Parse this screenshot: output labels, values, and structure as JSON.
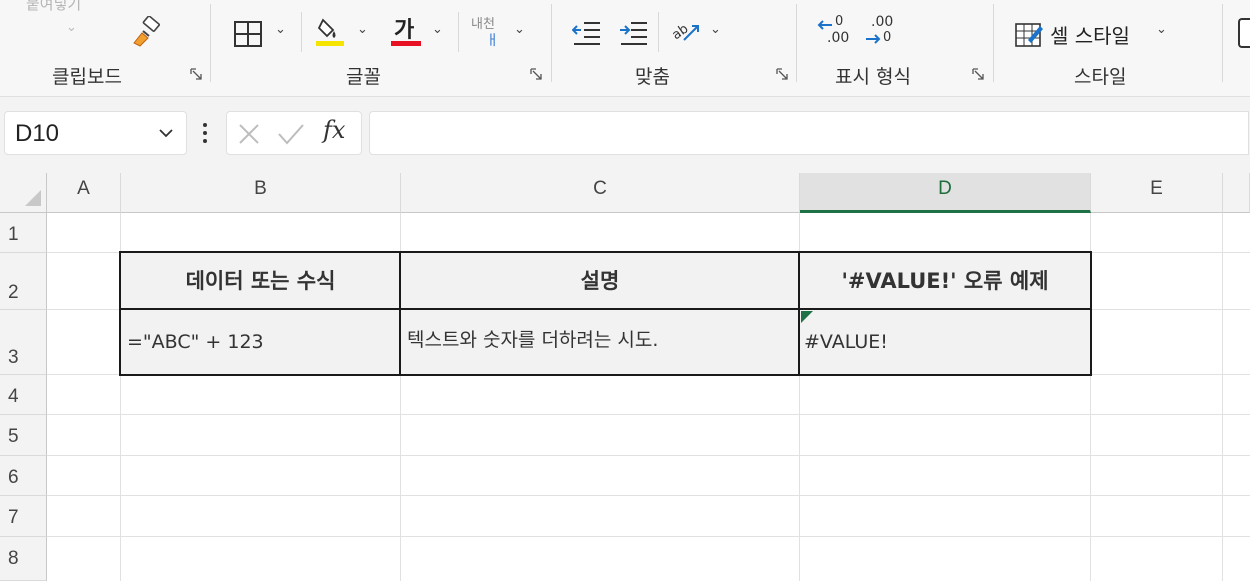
{
  "ribbon": {
    "top_faded_label": "붙여넣기",
    "groups": [
      {
        "label": "클립보드"
      },
      {
        "label": "글꼴"
      },
      {
        "label": "맞춤"
      },
      {
        "label": "표시 형식"
      },
      {
        "label": "스타일"
      }
    ],
    "font_color_glyph": "가",
    "wrap_text_glyph": "내천",
    "cell_style_label": "셀 스타일",
    "decrease_decimal": ".00",
    "increase_decimal": ".00",
    "accent_colors": {
      "highlight": "#f5e400",
      "font_color": "#e81123"
    }
  },
  "formula_bar": {
    "name_box_value": "D10",
    "formula_value": ""
  },
  "grid": {
    "columns": [
      "A",
      "B",
      "C",
      "D",
      "E"
    ],
    "active_column": "D",
    "rows": [
      "1",
      "2",
      "3",
      "4",
      "5",
      "6",
      "7",
      "8"
    ],
    "table": {
      "headers": [
        "데이터 또는 수식",
        "설명",
        "'#VALUE!' 오류 예제"
      ],
      "row": [
        "=\"ABC\" + 123",
        "텍스트와 숫자를 더하려는 시도.",
        "#VALUE!"
      ]
    }
  }
}
